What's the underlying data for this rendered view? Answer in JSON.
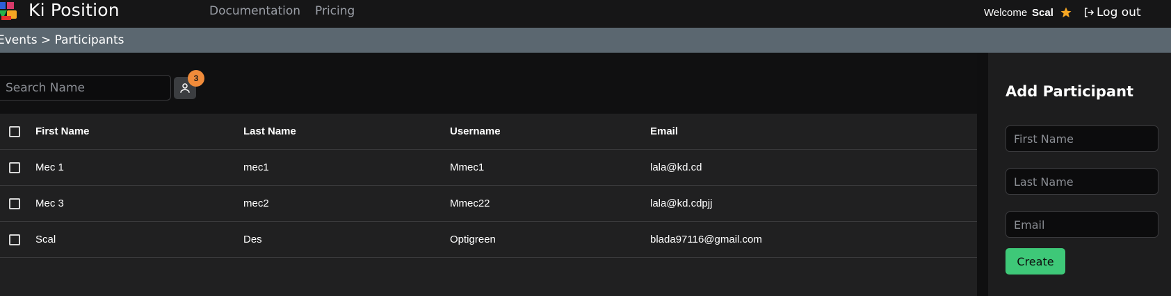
{
  "navbar": {
    "brand": "Ki Position",
    "links": [
      "Documentation",
      "Pricing"
    ],
    "welcome": "Welcome",
    "user_name": "Scal",
    "logout_label": "Log out",
    "star_color": "#f5a623"
  },
  "breadcrumb": "Events > Participants",
  "search": {
    "placeholder": "Search Name",
    "badge_count": "3"
  },
  "table": {
    "headers": {
      "first_name": "First Name",
      "last_name": "Last Name",
      "username": "Username",
      "email": "Email"
    },
    "rows": [
      {
        "first_name": "Mec 1",
        "last_name": "mec1",
        "username": "Mmec1",
        "email": "lala@kd.cd"
      },
      {
        "first_name": "Mec 3",
        "last_name": "mec2",
        "username": "Mmec22",
        "email": "lala@kd.cdpjj"
      },
      {
        "first_name": "Scal",
        "last_name": "Des",
        "username": "Optigreen",
        "email": "blada97116@gmail.com"
      }
    ]
  },
  "add_participant": {
    "title": "Add Participant",
    "first_name_placeholder": "First Name",
    "last_name_placeholder": "Last Name",
    "email_placeholder": "Email",
    "create_label": "Create"
  },
  "colors": {
    "accent_green": "#3ec878",
    "badge_orange": "#f08b3a",
    "breadcrumb_bg": "#5b6770"
  }
}
